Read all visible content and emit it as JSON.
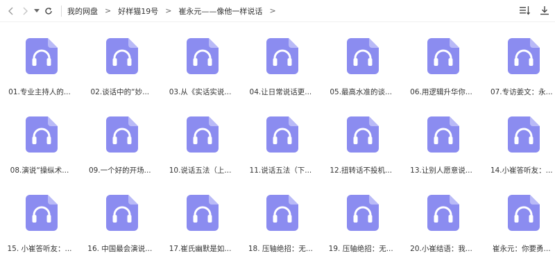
{
  "toolbar": {
    "breadcrumbs": [
      "我的网盘",
      "好样猫19号",
      "崔永元——像他一样说话"
    ],
    "trailing_separator": ">"
  },
  "files": [
    {
      "name": "01.专业主持人的..."
    },
    {
      "name": "02.谈话中的“妙..."
    },
    {
      "name": "03.从《实话实说..."
    },
    {
      "name": "04.让日常说话更..."
    },
    {
      "name": "05.最高水准的谈..."
    },
    {
      "name": "06.用逻辑升华你..."
    },
    {
      "name": "07.专访姜文：永..."
    },
    {
      "name": "08.演说“操纵术..."
    },
    {
      "name": "09.一个好的开场..."
    },
    {
      "name": "10.说话五法（上..."
    },
    {
      "name": "11.说话五法（下..."
    },
    {
      "name": "12.扭转话不投机..."
    },
    {
      "name": "13.让别人愿意说..."
    },
    {
      "name": "14.小崔答听友：..."
    },
    {
      "name": "15. 小崔答听友：..."
    },
    {
      "name": "16. 中国最会演说..."
    },
    {
      "name": "17.崔氏幽默是如..."
    },
    {
      "name": "18. 压轴绝招：无..."
    },
    {
      "name": "19. 压轴绝招：无..."
    },
    {
      "name": "20.小崔结语：我..."
    },
    {
      "name": "崔永元：你要勇..."
    }
  ],
  "colors": {
    "file_icon": "#8b8cf0",
    "file_icon_fold": "#b9baf7",
    "headphone": "#ffffff"
  }
}
